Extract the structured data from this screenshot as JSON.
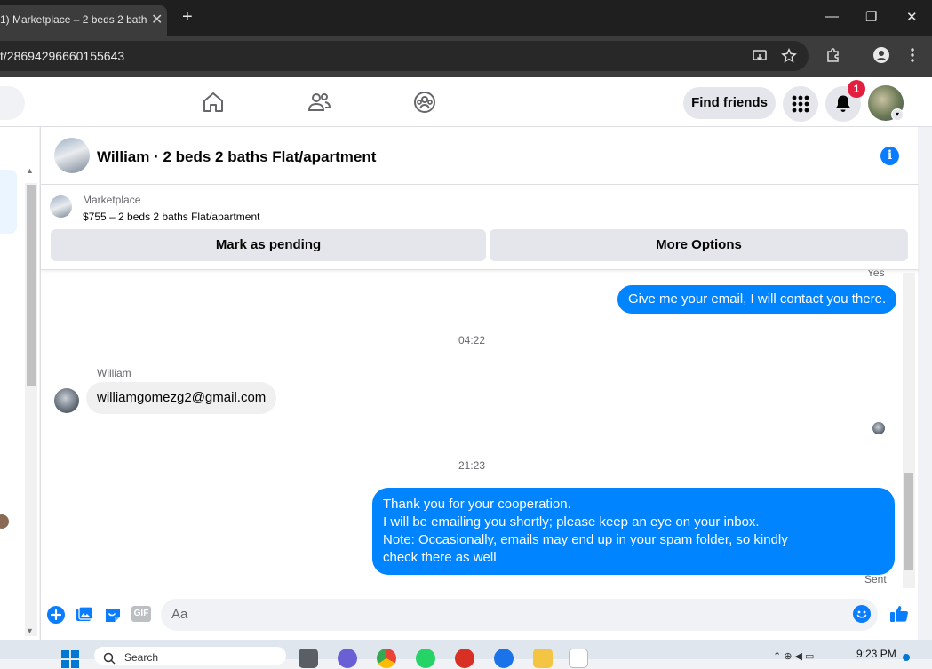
{
  "browser": {
    "tab_title": "1) Marketplace – 2 beds 2 bath",
    "tab_close": "✕",
    "new_tab": "+",
    "url": "t/28694296660155643",
    "window_controls": [
      "—",
      "❐",
      "✕"
    ]
  },
  "fb_nav": {
    "find_friends": "Find friends",
    "notification_count": "1"
  },
  "chat": {
    "header_title": "William · 2 beds 2 baths Flat/apartment",
    "listing_source": "Marketplace",
    "listing_title": "$755 – 2 beds 2 baths Flat/apartment",
    "mark_pending": "Mark as pending",
    "more_options": "More Options",
    "messages": [
      {
        "sender": "me",
        "status_above": "Yes",
        "lines": [
          "Give me your email, I will contact you there."
        ]
      },
      {
        "timestamp": "04:22"
      },
      {
        "sender": "William",
        "lines": [
          "williamgomezg2@gmail.com"
        ]
      },
      {
        "timestamp": "21:23"
      },
      {
        "sender": "me",
        "lines": [
          "Thank you for your cooperation.",
          "I will be emailing you shortly; please keep an eye on your inbox.",
          "Note: Occasionally, emails may end up in your spam folder, so kindly",
          "check there as well"
        ],
        "status": "Sent"
      }
    ],
    "composer_placeholder": "Aa",
    "gif_label": "GIF"
  },
  "taskbar": {
    "search_placeholder": "Search",
    "time": "9:23 PM"
  },
  "colors": {
    "accent": "#0084ff",
    "fb_blue": "#0a7cff",
    "badge_red": "#e41e3f"
  },
  "icons": [
    "home-icon",
    "friends-icon",
    "groups-icon",
    "menu-grid-icon",
    "bell-icon",
    "info-icon",
    "plus-icon",
    "photo-icon",
    "sticker-icon",
    "gif-icon",
    "emoji-icon",
    "like-icon",
    "star-icon",
    "extensions-icon",
    "cast-icon",
    "kebab-icon"
  ]
}
